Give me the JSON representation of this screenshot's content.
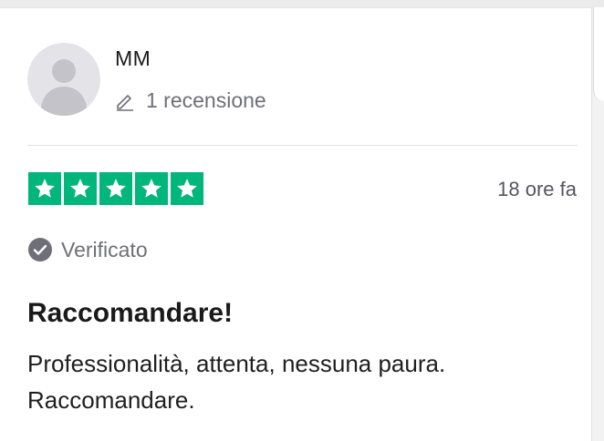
{
  "reviewer": {
    "name": "MM",
    "review_count": "1 recensione",
    "avatar_icon": "user-silhouette-icon",
    "edit_icon": "pencil-icon"
  },
  "rating": {
    "stars_filled": 5,
    "stars_total": 5,
    "star_color": "#00b67a"
  },
  "date": "18 ore fa",
  "verified": {
    "label": "Verificato",
    "icon": "check-circle-icon",
    "color": "#6f6f78"
  },
  "review": {
    "title": "Raccomandare!",
    "body": "Professionalità, attenta, nessuna paura. Raccomandare."
  }
}
